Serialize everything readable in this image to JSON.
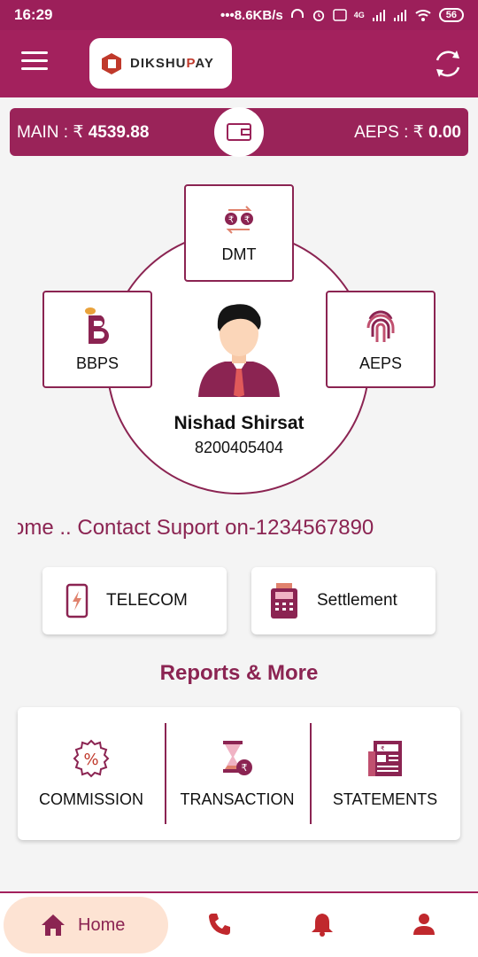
{
  "status_bar": {
    "time": "16:29",
    "net_speed": "8.6KB/s",
    "network_type": "4G",
    "battery": "56"
  },
  "app_bar": {
    "brand": "DIKSHUPAY",
    "brand_prefix": "DIKSHU",
    "brand_highlight": "P",
    "brand_suffix": "AY",
    "accent_color": "#a3215d"
  },
  "balance": {
    "main_label": "MAIN : ₹",
    "main_value": "4539.88",
    "aeps_label": "AEPS : ₹",
    "aeps_value": "0.00"
  },
  "services": {
    "dmt": "DMT",
    "bbps": "BBPS",
    "aeps": "AEPS"
  },
  "user": {
    "name": "Nishad Shirsat",
    "phone": "8200405404"
  },
  "marquee": "ome .. Contact Suport on-1234567890",
  "quick_actions": {
    "telecom": "TELECOM",
    "settlement": "Settlement"
  },
  "reports": {
    "title": "Reports & More",
    "commission": "COMMISSION",
    "transaction": "TRANSACTION",
    "statements": "STATEMENTS"
  },
  "bottom_nav": {
    "home": "Home"
  }
}
